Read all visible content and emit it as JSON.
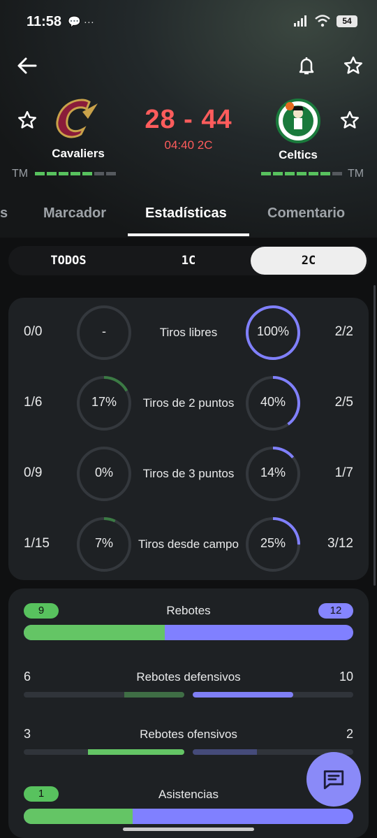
{
  "status_bar": {
    "time": "11:58",
    "notif_icons": "💬 ···",
    "battery": "54"
  },
  "match": {
    "home": {
      "name": "Cavaliers",
      "form_label": "TM",
      "form": [
        1,
        1,
        1,
        1,
        1,
        0,
        0
      ]
    },
    "away": {
      "name": "Celtics",
      "form_label": "TM",
      "form": [
        1,
        1,
        1,
        1,
        1,
        1,
        0
      ]
    },
    "score": "28 - 44",
    "clock": "04:40 2C"
  },
  "tabs": [
    {
      "label": "s",
      "active": false
    },
    {
      "label": "Marcador",
      "active": false
    },
    {
      "label": "Estadísticas",
      "active": true
    },
    {
      "label": "Comentario",
      "active": false
    }
  ],
  "periods": [
    {
      "label": "TODOS",
      "selected": false
    },
    {
      "label": "1C",
      "selected": false
    },
    {
      "label": "2C",
      "selected": true
    }
  ],
  "shooting": [
    {
      "label": "Tiros libres",
      "home_made": "0/0",
      "home_pct": "-",
      "home_frac": 0,
      "away_made": "2/2",
      "away_pct": "100%",
      "away_frac": 1.0
    },
    {
      "label": "Tiros de 2 puntos",
      "home_made": "1/6",
      "home_pct": "17%",
      "home_frac": 0.17,
      "away_made": "2/5",
      "away_pct": "40%",
      "away_frac": 0.4
    },
    {
      "label": "Tiros de 3 puntos",
      "home_made": "0/9",
      "home_pct": "0%",
      "home_frac": 0,
      "away_made": "1/7",
      "away_pct": "14%",
      "away_frac": 0.14
    },
    {
      "label": "Tiros desde campo",
      "home_made": "1/15",
      "home_pct": "7%",
      "home_frac": 0.07,
      "away_made": "3/12",
      "away_pct": "25%",
      "away_frac": 0.25
    }
  ],
  "rebounds": {
    "total": {
      "label": "Rebotes",
      "home": "9",
      "away": "12",
      "home_frac": 0.4286
    },
    "defensive": {
      "label": "Rebotes defensivos",
      "home": "6",
      "away": "10",
      "home_frac": 0.375,
      "away_frac": 0.625
    },
    "offensive": {
      "label": "Rebotes ofensivos",
      "home": "3",
      "away": "2",
      "home_frac": 0.6,
      "away_frac": 0.4
    }
  },
  "assists": {
    "label": "Asistencias",
    "home": "1",
    "home_frac": 0.33
  },
  "colors": {
    "home": "#58c25e",
    "away": "#8080ff",
    "score": "#ff5c5c"
  }
}
